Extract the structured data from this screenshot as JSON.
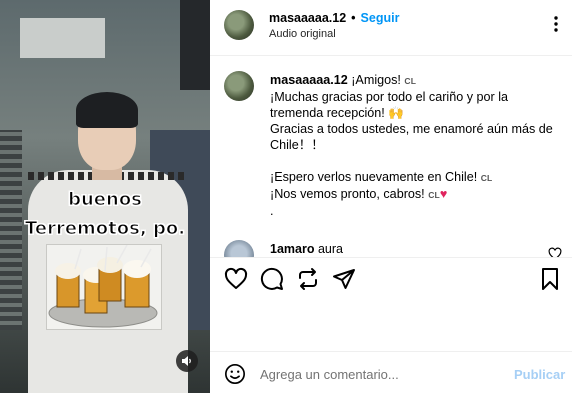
{
  "media": {
    "overlay_line_1": "buenos",
    "overlay_line_2": "Terremotos, po.",
    "mute_icon": "speaker-icon"
  },
  "header": {
    "username": "masaaaaa.12",
    "separator": "•",
    "follow_label": "Seguir",
    "audio_label": "Audio original",
    "more_icon": "more-options-icon"
  },
  "caption": {
    "username": "masaaaaa.12",
    "lines": [
      "¡Amigos!",
      "¡Muchas gracias por todo el cariño y por la",
      "tremenda recepción! 🙌",
      "Gracias a todos ustedes, me enamoré aún más de",
      "Chile！！",
      "",
      "¡Espero verlos nuevamente en Chile!",
      "¡Nos vemos pronto, cabros!",
      "."
    ],
    "flag_text": "CL",
    "heart": "♥"
  },
  "comment_2": {
    "username": "1amaro",
    "text": "aura"
  },
  "actions": {
    "like_icon": "heart-icon",
    "comment_icon": "comment-icon",
    "share_icon": "repost-icon",
    "send_icon": "send-icon",
    "save_icon": "bookmark-icon"
  },
  "comment_bar": {
    "emoji_icon": "emoji-icon",
    "placeholder": "Agrega un comentario...",
    "publish_label": "Publicar",
    "publish_color": "#a6cff5"
  }
}
